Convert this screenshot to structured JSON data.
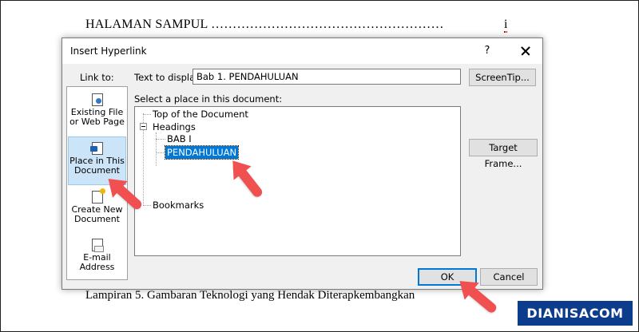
{
  "document": {
    "heading": "HALAMAN SAMPUL ………………………………………………",
    "page_number": "i",
    "footer": "Lampiran 5. Gambaran Teknologi yang Hendak Diterapkembangkan"
  },
  "watermark": "DIANISACOM",
  "dialog": {
    "title": "Insert Hyperlink",
    "help_label": "?",
    "link_to_label": "Link to:",
    "sidebar": [
      {
        "line1": "Existing File",
        "line2": "or Web Page",
        "icon": "existing-file-icon"
      },
      {
        "line1": "Place in This",
        "line2": "Document",
        "icon": "place-in-document-icon"
      },
      {
        "line1": "Create New",
        "line2": "Document",
        "icon": "create-new-document-icon"
      },
      {
        "line1": "E-mail",
        "line2": "Address",
        "icon": "email-address-icon"
      }
    ],
    "text_to_display_label": "Text to display:",
    "text_to_display_value": "Bab 1. PENDAHULUAN",
    "screentip_label": "ScreenTip...",
    "select_place_label": "Select a place in this document:",
    "tree": {
      "top": "Top of the Document",
      "headings": "Headings",
      "bab1": "BAB I",
      "pendahuluan": "PENDAHULUAN",
      "bookmarks": "Bookmarks"
    },
    "target_frame_label": "Target Frame...",
    "ok_label": "OK",
    "cancel_label": "Cancel"
  },
  "colors": {
    "selection": "#0078d7",
    "sidebar_selected": "#cce4f7",
    "arrow": "#f0504f",
    "watermark_bg": "#0d3c8c"
  }
}
